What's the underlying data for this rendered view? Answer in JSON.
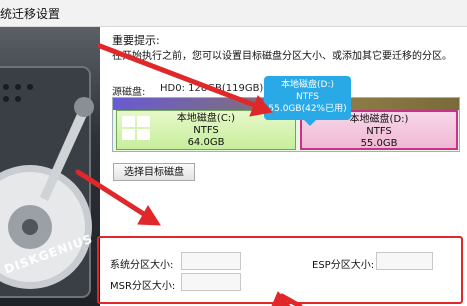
{
  "window": {
    "title": "统迁移设置"
  },
  "notice": {
    "title": "重要提示:",
    "text": "在开始执行之前，您可以设置目标磁盘分区大小、或添加其它要迁移的分区。"
  },
  "source_disk": {
    "label": "源磁盘:",
    "value": "HD0:    128GB(119GB)"
  },
  "partitions": [
    {
      "name": "本地磁盘(C:)",
      "fs": "NTFS",
      "size": "64.0GB"
    },
    {
      "name": "本地磁盘(D:)",
      "fs": "NTFS",
      "size": "55.0GB"
    }
  ],
  "tooltip": {
    "name": "本地磁盘(D:)",
    "fs": "NTFS",
    "usage": "55.0GB(42%已用)"
  },
  "buttons": {
    "select_target": "选择目标磁盘"
  },
  "size_fields": {
    "system_label": "系统分区大小:",
    "esp_label": "ESP分区大小:",
    "msr_label": "MSR分区大小:",
    "system_value": "",
    "esp_value": "",
    "msr_value": ""
  },
  "branding": {
    "logo_text": "DISKGENIUS"
  },
  "colors": {
    "highlight_red": "#e0282b",
    "tooltip_blue": "#2aa9e7",
    "partition_c": "#c6ee9c",
    "partition_d": "#f0b8d3"
  },
  "icons": [
    "windows-logo-icon",
    "hard-disk-illustration",
    "red-arrow-annotation"
  ]
}
